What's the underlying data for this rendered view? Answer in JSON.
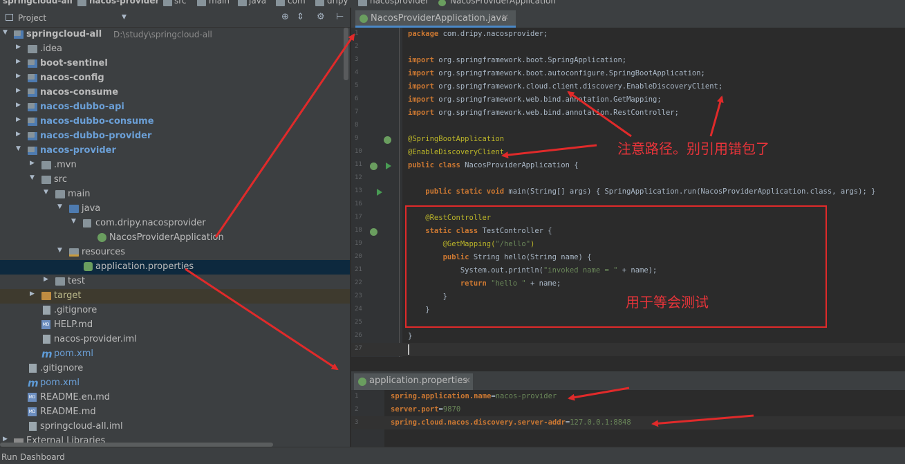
{
  "breadcrumbs": [
    "springcloud-all",
    "nacos-provider",
    "src",
    "main",
    "java",
    "com",
    "dripy",
    "nacosprovider",
    "NacosProviderApplication"
  ],
  "project_panel": {
    "title": "Project"
  },
  "tree": [
    {
      "label": "springcloud-all",
      "path": "D:\\study\\springcloud-all"
    },
    {
      "label": ".idea"
    },
    {
      "label": "boot-sentinel"
    },
    {
      "label": "nacos-config"
    },
    {
      "label": "nacos-consume"
    },
    {
      "label": "nacos-dubbo-api"
    },
    {
      "label": "nacos-dubbo-consume"
    },
    {
      "label": "nacos-dubbo-provider"
    },
    {
      "label": "nacos-provider"
    },
    {
      "label": ".mvn"
    },
    {
      "label": "src"
    },
    {
      "label": "main"
    },
    {
      "label": "java"
    },
    {
      "label": "com.dripy.nacosprovider"
    },
    {
      "label": "NacosProviderApplication"
    },
    {
      "label": "resources"
    },
    {
      "label": "application.properties"
    },
    {
      "label": "test"
    },
    {
      "label": "target"
    },
    {
      "label": ".gitignore"
    },
    {
      "label": "HELP.md"
    },
    {
      "label": "nacos-provider.iml"
    },
    {
      "label": "pom.xml"
    },
    {
      "label": ".gitignore"
    },
    {
      "label": "pom.xml"
    },
    {
      "label": "README.en.md"
    },
    {
      "label": "README.md"
    },
    {
      "label": "springcloud-all.iml"
    },
    {
      "label": "External Libraries"
    }
  ],
  "editor_tab": {
    "label": "NacosProviderApplication.java"
  },
  "code": {
    "l1a": "package",
    "l1b": " com.dripy.nacosprovider;",
    "l3a": "import",
    "l3b": " org.springframework.boot.SpringApplication;",
    "l4a": "import",
    "l4b": " org.springframework.boot.autoconfigure.SpringBootApplication;",
    "l5a": "import",
    "l5b": " org.springframework.cloud.client.discovery.EnableDiscoveryClient;",
    "l6a": "import",
    "l6b": " org.springframework.web.bind.annotation.GetMapping;",
    "l7a": "import",
    "l7b": " org.springframework.web.bind.annotation.RestController;",
    "l9": "@SpringBootApplication",
    "l10": "@EnableDiscoveryClient",
    "l11a": "public class",
    "l11b": " NacosProviderApplication {",
    "l13a": "    public static void",
    "l13b": " main(String[] args) { SpringApplication.run(NacosProviderApplication.class, args); }",
    "l17": "    @RestController",
    "l18a": "    static class",
    "l18b": " TestController {",
    "l19a": "        @GetMapping(",
    "l19b": "\"/hello\"",
    "l19c": ")",
    "l20a": "        public",
    "l20b": " String hello(String name) {",
    "l21a": "            System.out.println(",
    "l21b": "\"invoked name = \"",
    "l21c": " + name);",
    "l22a": "            return",
    "l22b": " \"hello \"",
    "l22c": " + name;",
    "l23": "        }",
    "l24": "    }",
    "l26": "}"
  },
  "line_numbers": [
    "1",
    "2",
    "3",
    "4",
    "5",
    "6",
    "7",
    "8",
    "9",
    "10",
    "11",
    "12",
    "13",
    "16",
    "17",
    "18",
    "19",
    "20",
    "21",
    "22",
    "23",
    "24",
    "25",
    "26",
    "27"
  ],
  "props_tab": {
    "label": "application.properties"
  },
  "props": [
    {
      "key": "spring.application.name",
      "sep": "=",
      "value": "nacos-provider"
    },
    {
      "key": "server.port",
      "sep": "=",
      "value": "9870"
    },
    {
      "key": "spring.cloud.nacos.discovery.server-addr",
      "sep": "=",
      "value": "127.0.0.1:8848"
    }
  ],
  "props_line_numbers": [
    "1",
    "2",
    "3"
  ],
  "annotations": {
    "path_note": "注意路径。别引用错包了",
    "test_note": "用于等会测试"
  },
  "bottom": {
    "label": "Run Dashboard"
  },
  "colors": {
    "keyword": "#cc7832",
    "annotation": "#bbb529",
    "string": "#6a8759",
    "markup_red": "#e02a2a"
  }
}
